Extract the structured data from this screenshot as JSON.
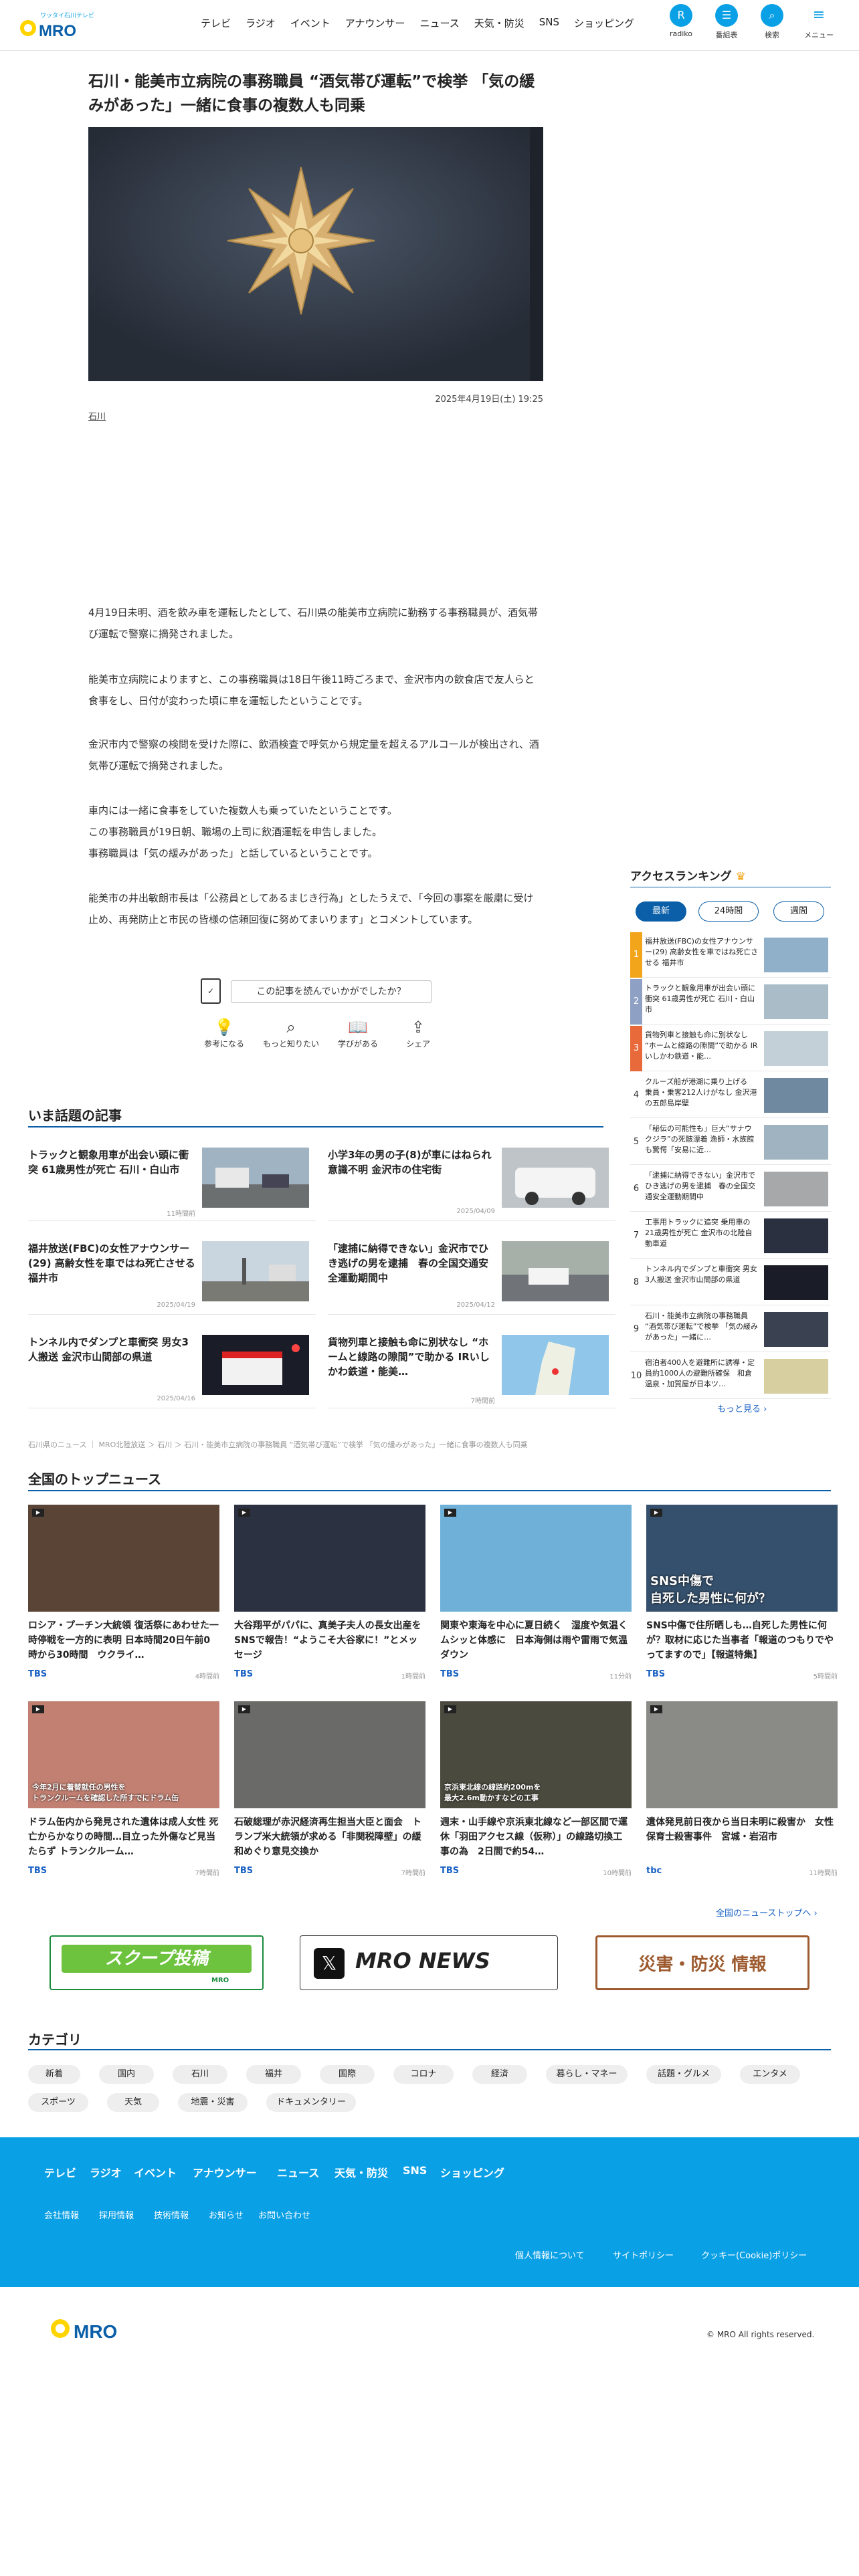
{
  "header": {
    "logo_text": "MRO",
    "logo_sub": "ワッタイ石川テレビ",
    "nav": [
      "テレビ",
      "ラジオ",
      "イベント",
      "アナウンサー",
      "ニュース",
      "天気・防災",
      "SNS",
      "ショッピング"
    ],
    "icons": [
      {
        "label": "radiko",
        "icon": "radiko-icon"
      },
      {
        "label": "番組表",
        "icon": "program-icon"
      },
      {
        "label": "検索",
        "icon": "search-icon"
      },
      {
        "label": "メニュー",
        "icon": "menu-icon"
      }
    ]
  },
  "article": {
    "title": "石川・能美市立病院の事務職員 “酒気帯び運転”で検挙 「気の緩みがあった」一緒に食事の複数人も同乗",
    "date": "2025年4月19日(土) 19:25",
    "tag": "石川",
    "paragraphs": [
      "4月19日未明、酒を飲み車を運転したとして、石川県の能美市立病院に勤務する事務職員が、酒気帯び運転で警察に摘発されました。",
      "能美市立病院によりますと、この事務職員は18日午後11時ごろまで、金沢市内の飲食店で友人らと食事をし、日付が変わった頃に車を運転したということです。",
      "金沢市内で警察の検問を受けた際に、飲酒検査で呼気から規定量を超えるアルコールが検出され、酒気帯び運転で摘発されました。",
      "車内には一緒に食事をしていた複数人も乗っていたということです。\nこの事務職員が19日朝、職場の上司に飲酒運転を申告しました。\n事務職員は「気の緩みがあった」と話しているということです。",
      "能美市の井出敏朗市長は「公務員としてあるまじき行為」としたうえで、「今回の事案を厳粛に受け止め、再発防止と市民の皆様の信頼回復に努めてまいります」とコメントしています。"
    ],
    "survey_label": "この記事を読んでいかがでしたか？",
    "reactions": [
      "参考になる",
      "もっと知りたい",
      "学びがある",
      "シェア"
    ]
  },
  "trending": {
    "heading": "いま話題の記事",
    "items": [
      {
        "title": "トラックと観象用車が出会い頭に衝突 61歳男性が死亡 石川・白山市",
        "date": "11時間前"
      },
      {
        "title": "小学3年の男の子(8)が車にはねられ意識不明 金沢市の住宅街",
        "date": "2025/04/09"
      },
      {
        "title": "福井放送(FBC)の女性アナウンサー(29) 高齢女性を車ではね死亡させる 福井市",
        "date": "2025/04/19"
      },
      {
        "title": "「逮捕に納得できない」金沢市でひき逃げの男を逮捕　春の全国交通安全運動期間中",
        "date": "2025/04/12"
      },
      {
        "title": "トンネル内でダンプと車衝突 男女3人搬送 金沢市山間部の県道",
        "date": "2025/04/16"
      },
      {
        "title": "貨物列車と接触も命に別状なし “ホームと線路の隙間”で助かる IRいしかわ鉄道・能美…",
        "date": "7時間前"
      }
    ]
  },
  "ranking": {
    "heading": "アクセスランキング",
    "tabs": [
      "最新",
      "24時間",
      "週間"
    ],
    "items": [
      {
        "rank": "1",
        "title": "福井放送(FBC)の女性アナウンサー(29) 高齢女性を車ではね死亡させる 福井市"
      },
      {
        "rank": "2",
        "title": "トラックと観象用車が出会い頭に衝突 61歳男性が死亡 石川・白山市"
      },
      {
        "rank": "3",
        "title": "貨物列車と接触も命に別状なし “ホームと線路の隙間”で助かる IRいしかわ鉄道・能…"
      },
      {
        "rank": "4",
        "title": "クルーズ船が港湖に乗り上げる　乗員・乗客212人けがなし 金沢港の五郎島岸壁"
      },
      {
        "rank": "5",
        "title": "「秘伝の可能性も」巨大“サナウクジラ”の死骸漂着 漁師・水族館も驚愕「安易に近…"
      },
      {
        "rank": "6",
        "title": "「逮捕に納得できない」金沢市でひき逃げの男を逮捕　春の全国交通安全運動期間中"
      },
      {
        "rank": "7",
        "title": "工事用トラックに追突 乗用車の21歳男性が死亡 金沢市の北陸自動車道"
      },
      {
        "rank": "8",
        "title": "トンネル内でダンプと車衝突 男女3人搬送 金沢市山間部の県道"
      },
      {
        "rank": "9",
        "title": "石川・能美市立病院の事務職員 “酒気帯び運転”で検挙 「気の緩みがあった」一緒に…"
      },
      {
        "rank": "10",
        "title": "宿泊者400人を避難所に誘導・定員約1000人の避難所確保　和倉温泉・加賀屋が日本ツ…"
      }
    ],
    "more": "もっと見る"
  },
  "breadcrumb": "石川県のニュース ｜ MRO北陸放送 ＞ 石川 ＞ 石川・能美市立病院の事務職員 “酒気帯び運転”で検挙 「気の緩みがあった」一緒に食事の複数人も同乗",
  "national": {
    "heading": "全国のトップニュース",
    "items": [
      {
        "title": "ロシア・プーチン大統領 復活祭にあわせた一時停戦を一方的に表明 日本時間20日午前0時から30時間　ウクライ…",
        "source": "TBS",
        "date": "4時間前"
      },
      {
        "title": "大谷翔平がパパに、真美子夫人の長女出産をSNSで報告！“ようこそ大谷家に！”とメッセージ",
        "source": "TBS",
        "date": "1時間前"
      },
      {
        "title": "関東や東海を中心に夏日続く　湿度や気温くムシッと体感に　日本海側は雨や雷雨で気温ダウン",
        "source": "TBS",
        "date": "11分前"
      },
      {
        "title": "SNS中傷で住所晒しも…自死した男性に何が？取材に応じた当事者「報道のつもりでやってますので」【報道特集】",
        "source": "TBS",
        "date": "5時間前"
      },
      {
        "title": "ドラム缶内から発見された遺体は成人女性 死亡からかなりの時間…目立った外傷など見当たらず トランクルーム…",
        "source": "TBS",
        "date": "7時間前"
      },
      {
        "title": "石破総理が赤沢経済再生担当大臣と面会　トランプ米大統領が求める「非関税障壁」の緩和めぐり意見交換か",
        "source": "TBS",
        "date": "7時間前"
      },
      {
        "title": "週末・山手線や京浜東北線など一部区間で運休「羽田アクセス線（仮称）」の線路切換工事の為　2日間で約54…",
        "source": "TBS",
        "date": "10時間前"
      },
      {
        "title": "遺体発見前日夜から当日未明に殺害か　女性保育士殺害事件　宮城・岩沼市",
        "source": "tbc",
        "date": "11時間前"
      }
    ],
    "thumb_overlays": [
      "",
      "",
      "",
      "SNS中傷で\n自死した男性に何が？",
      "今年2月に着替就任の男性を\nトランクルームを確認した所すでにドラム缶",
      "",
      "京浜東北線の線路約200mを\n最大2.6m動かすなどの工事",
      ""
    ],
    "more": "全国のニューストップへ"
  },
  "banners": [
    "スクープ投稿",
    "MRO NEWS",
    "災害・防災 情報"
  ],
  "banner_sub": "MRO",
  "category": {
    "heading": "カテゴリ",
    "items": [
      "新着",
      "国内",
      "石川",
      "福井",
      "国際",
      "コロナ",
      "経済",
      "暮らし・マネー",
      "話題・グルメ",
      "エンタメ",
      "スポーツ",
      "天気",
      "地震・災害",
      "ドキュメンタリー"
    ]
  },
  "footer": {
    "nav": [
      "テレビ",
      "ラジオ",
      "イベント",
      "アナウンサー",
      "ニュース",
      "天気・防災",
      "SNS",
      "ショッピング"
    ],
    "sub": [
      "会社情報",
      "採用情報",
      "技術情報",
      "お知らせ",
      "お問い合わせ"
    ],
    "legal": [
      "個人情報について",
      "サイトポリシー",
      "クッキー(Cookie)ポリシー"
    ],
    "copyright": "© MRO All rights reserved."
  },
  "colors": {
    "accent": "#0aa0e6",
    "navy": "#0a5fa8",
    "rank1": "#f2a51b",
    "rank2": "#8ea0c4",
    "rank3": "#e8693a",
    "rankN": "#333333"
  }
}
